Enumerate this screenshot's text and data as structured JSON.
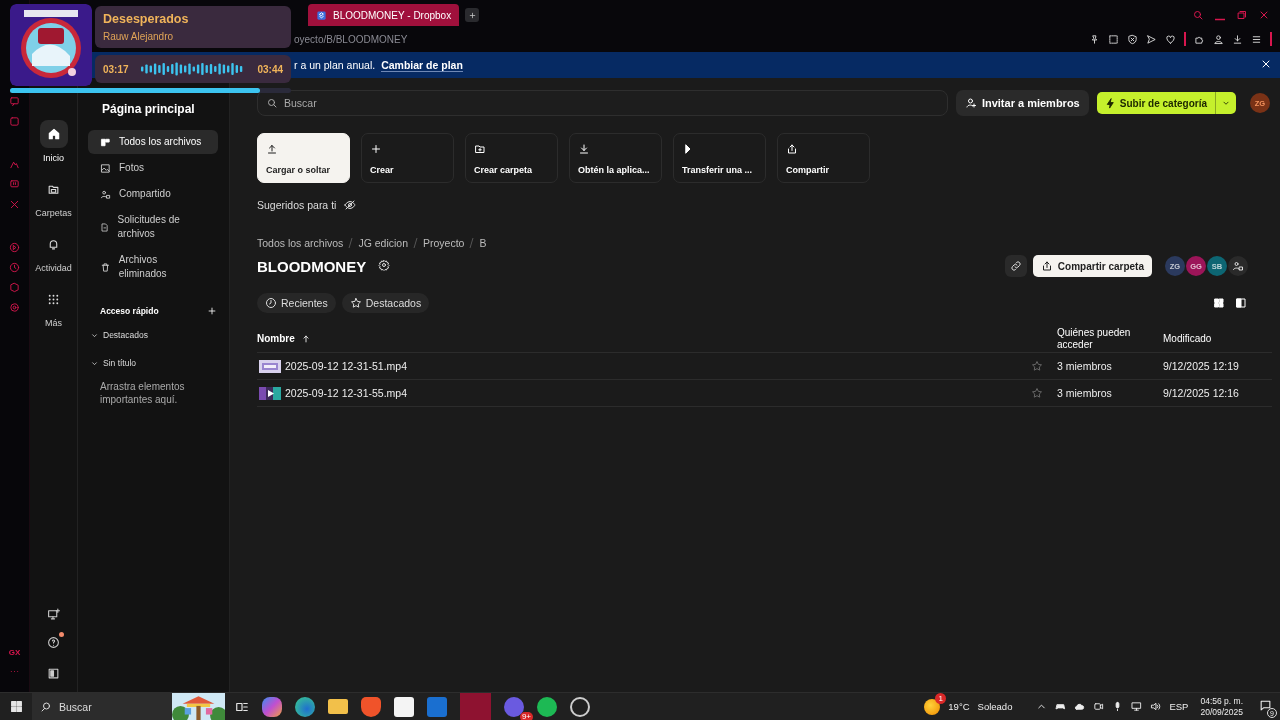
{
  "music_widget": {
    "title": "Desesperados",
    "artist": "Rauw Alejandro",
    "elapsed": "03:17",
    "duration": "03:44",
    "level": 0.89
  },
  "browser": {
    "tab": {
      "title": "BLOODMONEY - Dropbox",
      "selected": true
    },
    "address": "oyecto/B/BLOODMONEY",
    "gx_label": "GX"
  },
  "banner": {
    "text": "r a un plan anual.",
    "link": "Cambiar de plan"
  },
  "nav_rail": [
    {
      "label": "Inicio",
      "selected": true
    },
    {
      "label": "Carpetas",
      "selected": false
    },
    {
      "label": "Actividad",
      "selected": false
    },
    {
      "label": "Más",
      "selected": false
    }
  ],
  "sidebar": {
    "title": "Página principal",
    "items": [
      {
        "label": "Todos los archivos",
        "selected": true
      },
      {
        "label": "Fotos",
        "selected": false
      },
      {
        "label": "Compartido",
        "selected": false
      },
      {
        "label": "Solicitudes de archivos",
        "selected": false
      },
      {
        "label": "Archivos eliminados",
        "selected": false
      }
    ],
    "quick_access": {
      "title": "Acceso rápido",
      "sections": [
        {
          "label": "Destacados",
          "expanded": true
        },
        {
          "label": "Sin título",
          "expanded": true,
          "hint": "Arrastra elementos importantes aquí."
        }
      ]
    }
  },
  "toolbar": {
    "search_placeholder": "Buscar",
    "invite": "Invitar a miembros",
    "upgrade": "Subir de categoría",
    "avatar": "ZG"
  },
  "actions": [
    {
      "label": "Cargar o soltar",
      "kind": "primary"
    },
    {
      "label": "Crear",
      "kind": "secondary"
    },
    {
      "label": "Crear carpeta",
      "kind": "secondary"
    },
    {
      "label": "Obtén la aplica...",
      "kind": "secondary"
    },
    {
      "label": "Transferir una ...",
      "kind": "secondary"
    },
    {
      "label": "Compartir",
      "kind": "secondary"
    }
  ],
  "suggested": "Sugeridos para ti",
  "breadcrumb": [
    "Todos los archivos",
    "JG edicion",
    "Proyecto",
    "B"
  ],
  "folder": {
    "title": "BLOODMONEY",
    "share": "Compartir carpeta",
    "members": [
      {
        "initials": "ZG",
        "color": "#2b3a5e"
      },
      {
        "initials": "GG",
        "color": "#9c1559"
      },
      {
        "initials": "SB",
        "color": "#0d6673"
      }
    ]
  },
  "filters": [
    {
      "label": "Recientes"
    },
    {
      "label": "Destacados"
    }
  ],
  "table": {
    "columns": [
      "Nombre",
      "Quiénes pueden acceder",
      "Modificado"
    ],
    "rows": [
      {
        "name": "2025-09-12 12-31-51.mp4",
        "starred": false,
        "access": "3 miembros",
        "modified": "9/12/2025 12:19"
      },
      {
        "name": "2025-09-12 12-31-55.mp4",
        "starred": false,
        "access": "3 miembros",
        "modified": "9/12/2025 12:16"
      }
    ]
  },
  "taskbar": {
    "search_placeholder": "Buscar",
    "app_badge": "9+",
    "weather_badge": "1",
    "temperature": "19°C",
    "condition": "Soleado",
    "language": "ESP",
    "time": "04:56 p. m.",
    "date": "20/09/2025",
    "notifications": "9"
  }
}
